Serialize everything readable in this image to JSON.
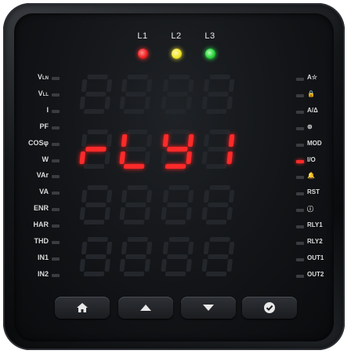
{
  "phase_lamps": [
    {
      "label": "L1",
      "color": "red"
    },
    {
      "label": "L2",
      "color": "yellow"
    },
    {
      "label": "L3",
      "color": "green"
    }
  ],
  "left_labels": [
    {
      "main": "V",
      "sub": "LN"
    },
    {
      "main": "V",
      "sub": "LL"
    },
    {
      "main": "I",
      "sub": ""
    },
    {
      "main": "PF",
      "sub": ""
    },
    {
      "main": "COSφ",
      "sub": ""
    },
    {
      "main": "W",
      "sub": ""
    },
    {
      "main": "VAr",
      "sub": ""
    },
    {
      "main": "VA",
      "sub": ""
    },
    {
      "main": "ENR",
      "sub": ""
    },
    {
      "main": "HAR",
      "sub": ""
    },
    {
      "main": "THD",
      "sub": ""
    },
    {
      "main": "IN1",
      "sub": ""
    },
    {
      "main": "IN2",
      "sub": ""
    }
  ],
  "right_labels": [
    "A☆",
    "🔒",
    "A/Δ",
    "⊚",
    "MOD",
    "I/O",
    "🔔",
    "RST",
    "ⓘ",
    "RLY1",
    "RLY2",
    "OUT1",
    "OUT2"
  ],
  "active_right_indicator": "I/O",
  "display": {
    "row2_text": "rLY1",
    "accent_color": "#ff2a2a"
  },
  "buttons": [
    {
      "name": "home-button",
      "icon": "home-icon"
    },
    {
      "name": "up-button",
      "icon": "up-arrow-icon"
    },
    {
      "name": "down-button",
      "icon": "down-arrow-icon"
    },
    {
      "name": "confirm-button",
      "icon": "check-icon"
    }
  ]
}
